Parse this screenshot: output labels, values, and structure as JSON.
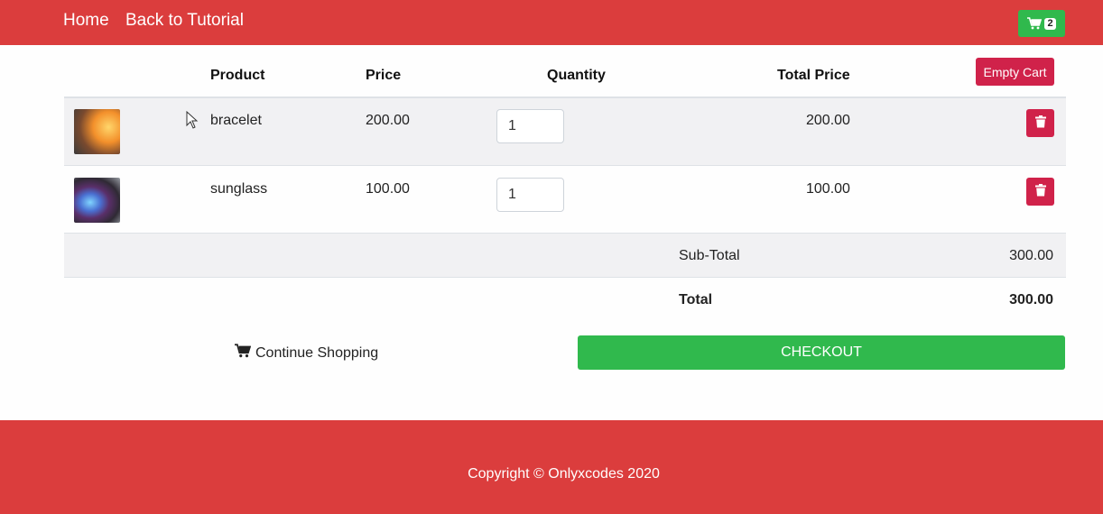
{
  "navbar": {
    "home_label": "Home",
    "back_label": "Back to Tutorial",
    "cart_count": "2",
    "bg_color": "#db3d3d",
    "cart_color": "#30b94d",
    "cart_icon": "shopping-cart-icon"
  },
  "cart": {
    "headers": {
      "product": "Product",
      "price": "Price",
      "quantity": "Quantity",
      "total_price": "Total Price"
    },
    "empty_label": "Empty Cart",
    "items": [
      {
        "product": "bracelet",
        "price": "200.00",
        "quantity": "1",
        "total": "200.00",
        "thumb_icon": "bracelet-thumbnail"
      },
      {
        "product": "sunglass",
        "price": "100.00",
        "quantity": "1",
        "total": "100.00",
        "thumb_icon": "sunglass-thumbnail"
      }
    ],
    "subtotal_label": "Sub-Total",
    "subtotal_value": "300.00",
    "total_label": "Total",
    "total_value": "300.00",
    "delete_icon": "trash-icon",
    "delete_color": "#d0224a"
  },
  "actions": {
    "continue_label": "Continue Shopping",
    "continue_icon": "shopping-cart-icon",
    "checkout_label": "CHECKOUT",
    "checkout_color": "#30b94d"
  },
  "footer": {
    "copyright": "Copyright © Onlyxcodes 2020"
  }
}
